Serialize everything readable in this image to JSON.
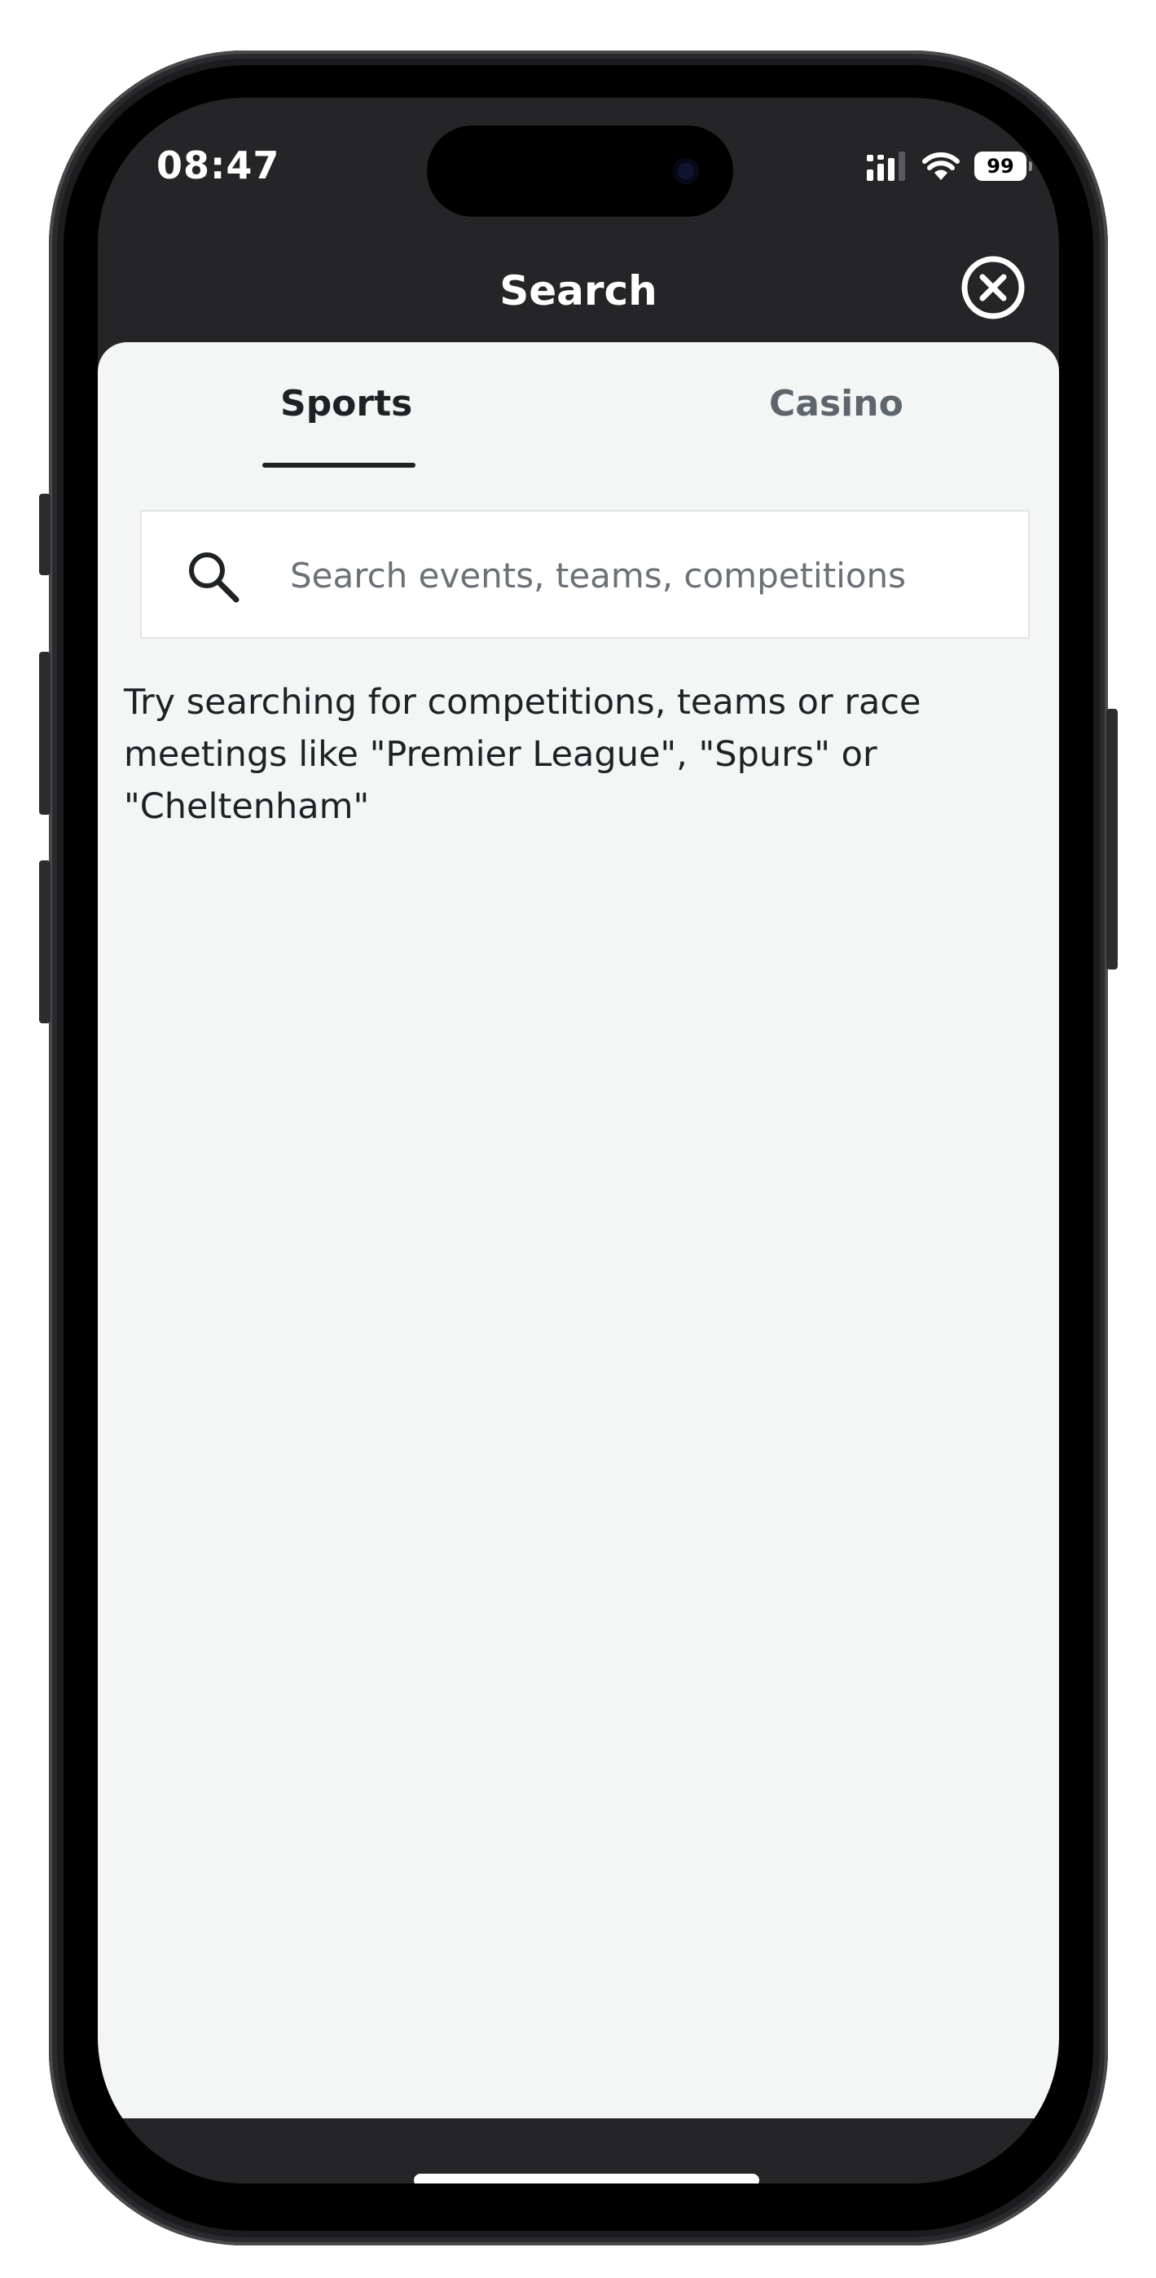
{
  "status_bar": {
    "time": "08:47",
    "battery": "99",
    "icons": [
      "signal-icon",
      "wifi-icon",
      "battery-icon"
    ]
  },
  "header": {
    "title": "Search",
    "close_icon": "close-circle-icon"
  },
  "tabs": [
    {
      "label": "Sports",
      "active": true
    },
    {
      "label": "Casino",
      "active": false
    }
  ],
  "search": {
    "placeholder": "Search events, teams, competitions",
    "value": "",
    "icon": "search-icon"
  },
  "hint": "Try searching for competitions, teams or race meetings like \"Premier League\", \"Spurs\" or \"Cheltenham\"",
  "colors": {
    "header_background": "#252527",
    "sheet_background": "#f4f5f5",
    "active_tab": "#1f2225",
    "inactive_tab": "#5e656c"
  }
}
